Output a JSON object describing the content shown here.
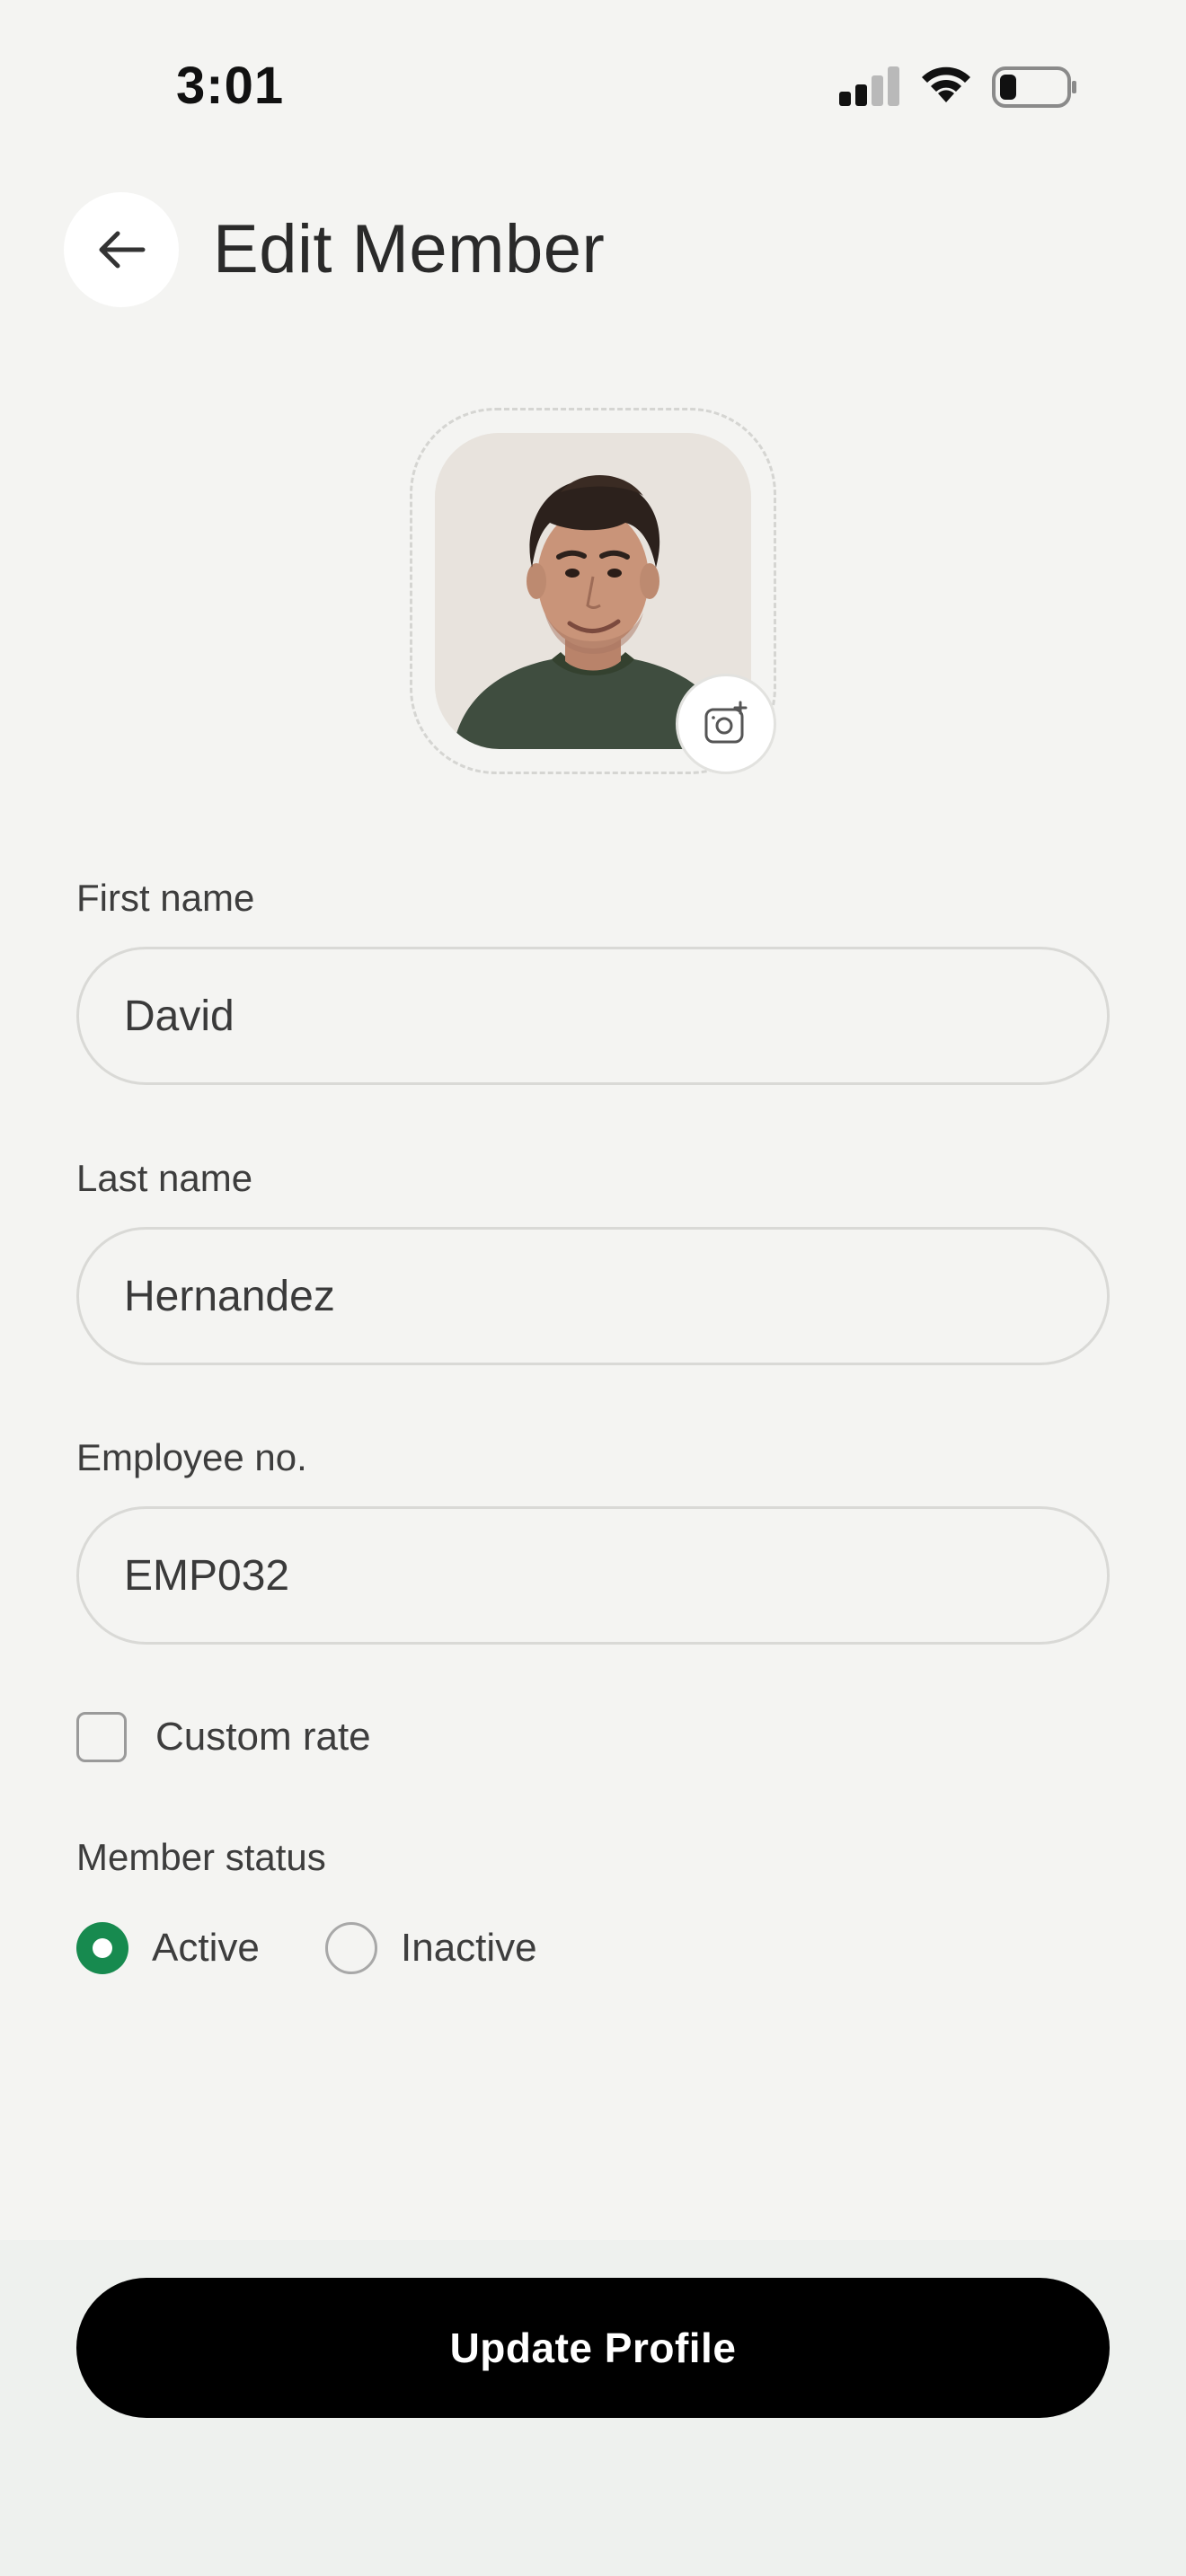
{
  "status_bar": {
    "time": "3:01"
  },
  "header": {
    "title": "Edit Member",
    "back_icon": "arrow-left-icon"
  },
  "avatar": {
    "camera_icon": "camera-plus-icon"
  },
  "form": {
    "first_name": {
      "label": "First name",
      "value": "David"
    },
    "last_name": {
      "label": "Last name",
      "value": "Hernandez"
    },
    "employee_no": {
      "label": "Employee no.",
      "value": "EMP032"
    },
    "custom_rate": {
      "label": "Custom rate",
      "checked": false
    },
    "member_status": {
      "label": "Member status",
      "options": [
        {
          "label": "Active",
          "selected": true
        },
        {
          "label": "Inactive",
          "selected": false
        }
      ]
    }
  },
  "footer": {
    "submit_label": "Update Profile"
  },
  "colors": {
    "background": "#f4f4f2",
    "accent": "#178a4f",
    "button": "#000000"
  }
}
